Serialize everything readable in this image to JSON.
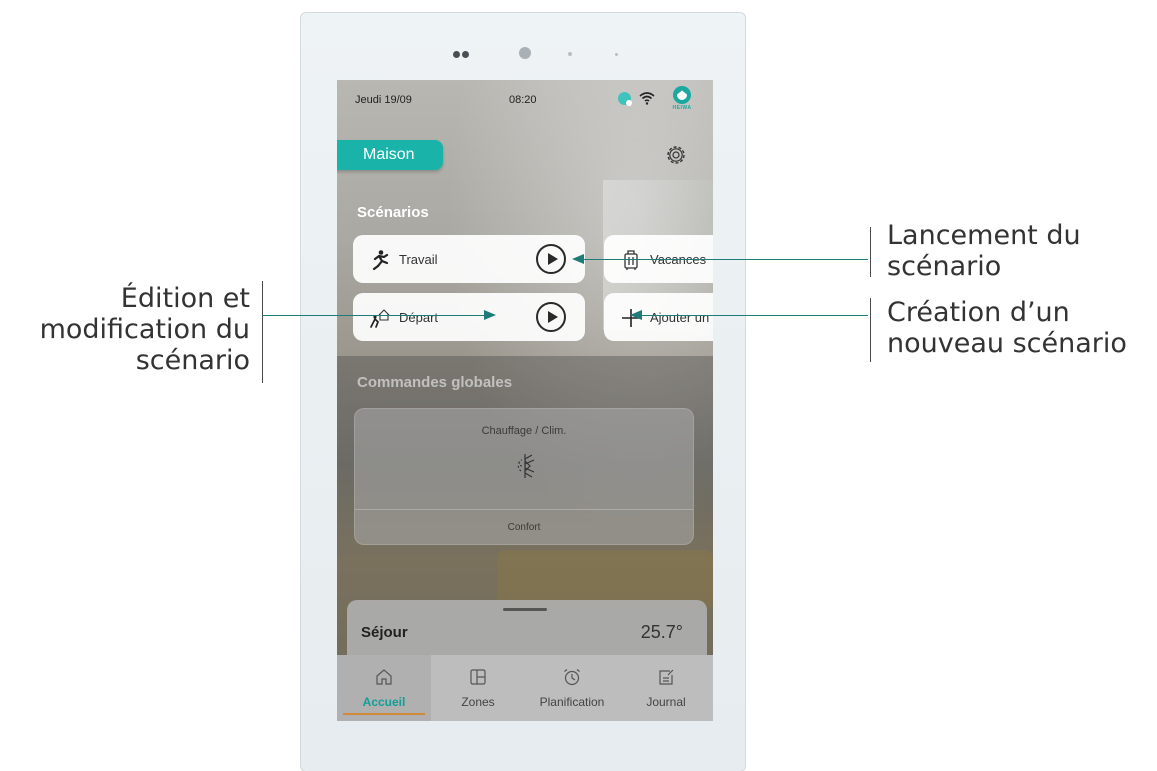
{
  "status": {
    "date": "Jeudi 19/09",
    "time": "08:20",
    "brand": "HEIWA"
  },
  "header": {
    "home_label": "Maison"
  },
  "scenarios": {
    "title": "Scénarios",
    "items": [
      {
        "label": "Travail",
        "icon": "running-person-icon"
      },
      {
        "label": "Vacances",
        "icon": "suitcase-icon"
      },
      {
        "label": "Départ",
        "icon": "leaving-home-icon"
      },
      {
        "label": "Ajouter un",
        "icon": "plus-icon"
      }
    ]
  },
  "global_commands": {
    "title": "Commandes globales",
    "card_title": "Chauffage / Clim.",
    "mode": "Confort"
  },
  "room": {
    "name": "Séjour",
    "temperature": "25.7°"
  },
  "nav": {
    "items": [
      {
        "label": "Accueil",
        "icon": "home-icon"
      },
      {
        "label": "Zones",
        "icon": "zones-icon"
      },
      {
        "label": "Planification",
        "icon": "alarm-clock-icon"
      },
      {
        "label": "Journal",
        "icon": "journal-icon"
      }
    ]
  },
  "annotations": {
    "launch_line1": "Lancement du",
    "launch_line2": "scénario",
    "create_line1": "Création d’un",
    "create_line2": "nouveau scénario",
    "edit_line1": "Édition et",
    "edit_line2": "modification du",
    "edit_line3": "scénario"
  },
  "colors": {
    "accent": "#19b3aa",
    "leader_line": "#1d7c78",
    "nav_underline": "#d08a3a"
  }
}
